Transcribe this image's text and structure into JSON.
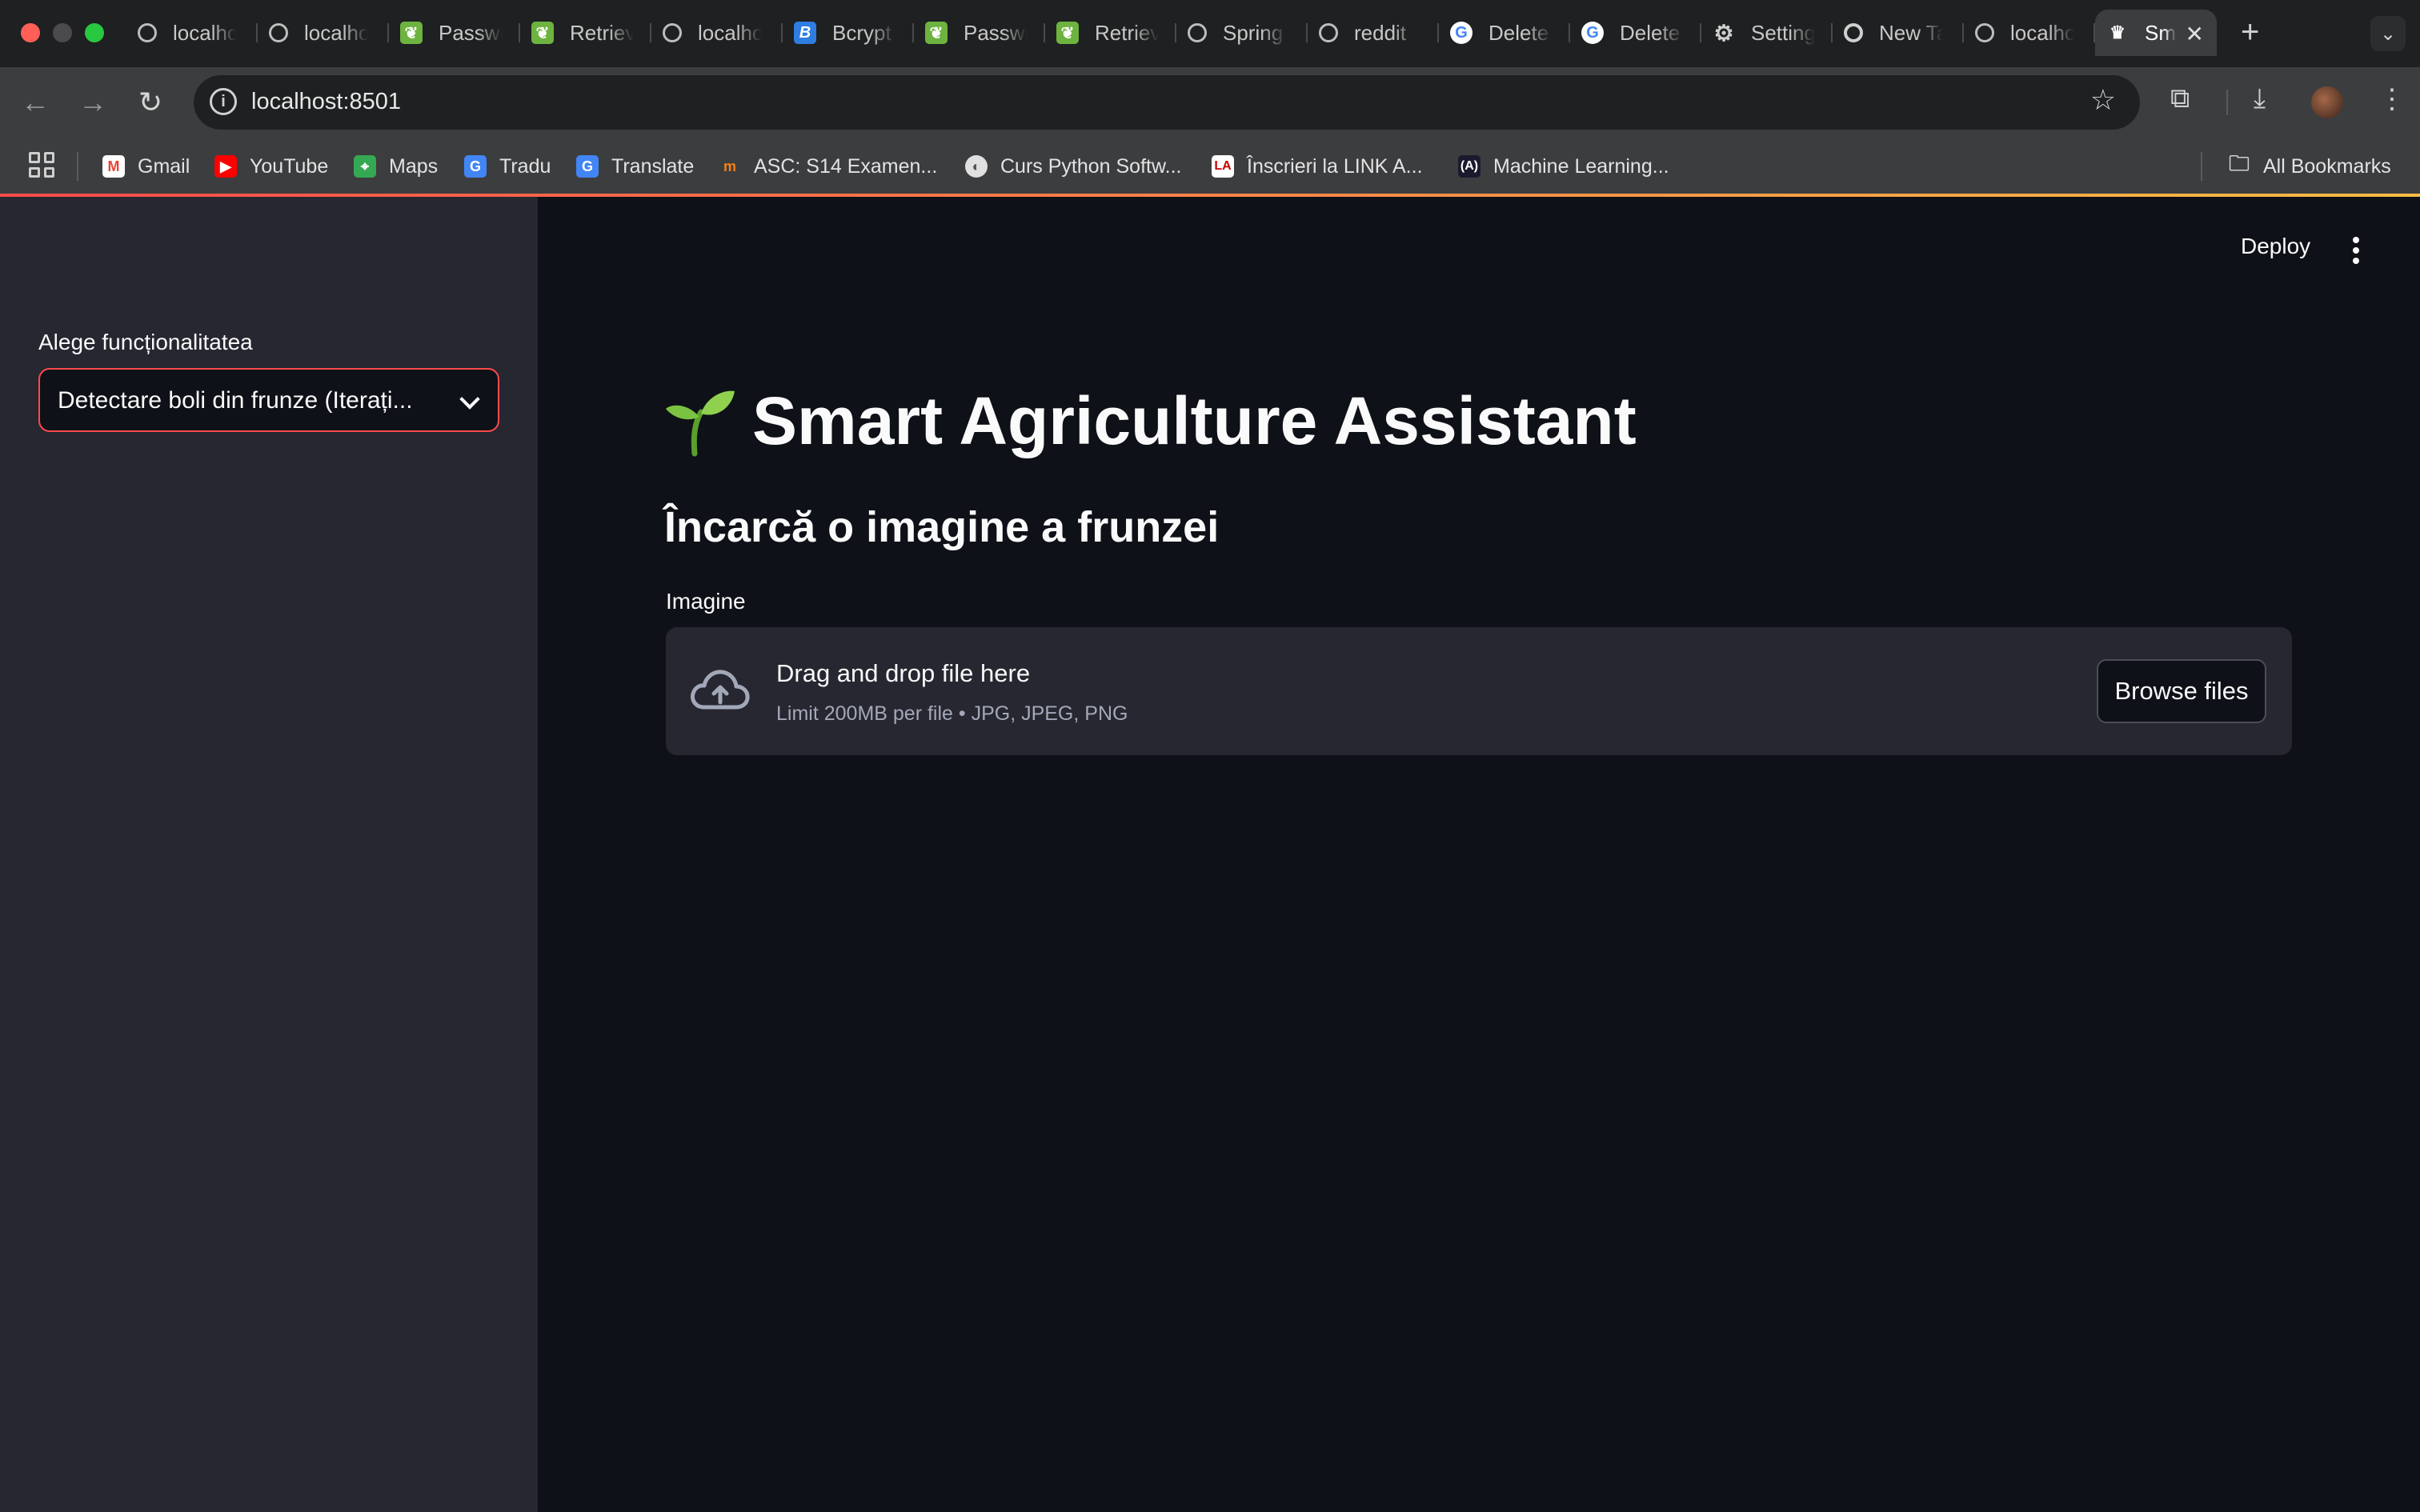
{
  "browser": {
    "tabs": [
      {
        "label": "localhost",
        "icon": "globe-icon"
      },
      {
        "label": "localhost",
        "icon": "globe-icon"
      },
      {
        "label": "Password",
        "icon": "spring-leaf-icon"
      },
      {
        "label": "Retrieve",
        "icon": "spring-leaf-icon"
      },
      {
        "label": "localhost",
        "icon": "globe-icon"
      },
      {
        "label": "Bcrypt",
        "icon": "bcrypt-b-icon"
      },
      {
        "label": "Password",
        "icon": "spring-leaf-icon"
      },
      {
        "label": "Retrieve",
        "icon": "spring-leaf-icon"
      },
      {
        "label": "Spring",
        "icon": "globe-icon"
      },
      {
        "label": "reddit",
        "icon": "globe-icon"
      },
      {
        "label": "Delete",
        "icon": "google-icon"
      },
      {
        "label": "Delete",
        "icon": "google-icon"
      },
      {
        "label": "Settings",
        "icon": "gear-icon"
      },
      {
        "label": "New Tab",
        "icon": "chrome-icon"
      },
      {
        "label": "localhost",
        "icon": "globe-icon"
      },
      {
        "label": "Smart",
        "icon": "streamlit-crown-icon",
        "active": true
      }
    ],
    "url": "localhost:8501",
    "bookmarks": [
      {
        "label": "Gmail",
        "icon": "gmail-icon",
        "color": "#ea4335"
      },
      {
        "label": "YouTube",
        "icon": "youtube-icon",
        "color": "#ff0000"
      },
      {
        "label": "Maps",
        "icon": "maps-icon",
        "color": "#34a853"
      },
      {
        "label": "Tradu",
        "icon": "translate-icon",
        "color": "#4285f4"
      },
      {
        "label": "Translate",
        "icon": "translate-icon",
        "color": "#4285f4"
      },
      {
        "label": "ASC: S14 Examen...",
        "icon": "moodle-icon",
        "color": "#f98012"
      },
      {
        "label": "Curs Python Softw...",
        "icon": "python-course-icon",
        "color": "#e0e0e0"
      },
      {
        "label": "Înscrieri la LINK A...",
        "icon": "link-academy-icon",
        "color": "#ffffff"
      },
      {
        "label": "Machine Learning...",
        "icon": "ml-icon",
        "color": "#1a1a2e"
      }
    ],
    "all_bookmarks": "All Bookmarks"
  },
  "sidebar": {
    "select_label": "Alege funcționalitatea",
    "select_value": "Detectare boli din frunze (Iterați..."
  },
  "header": {
    "deploy": "Deploy"
  },
  "main": {
    "title": "Smart Agriculture Assistant",
    "title_icon": "seedling-icon",
    "subtitle": "Încarcă o imagine a frunzei",
    "uploader_label": "Imagine",
    "dropzone_main": "Drag and drop file here",
    "dropzone_sub": "Limit 200MB per file • JPG, JPEG, PNG",
    "browse_label": "Browse files"
  },
  "colors": {
    "accent": "#ff4b4b",
    "sidebar_bg": "#262730",
    "main_bg": "#0e1117"
  }
}
